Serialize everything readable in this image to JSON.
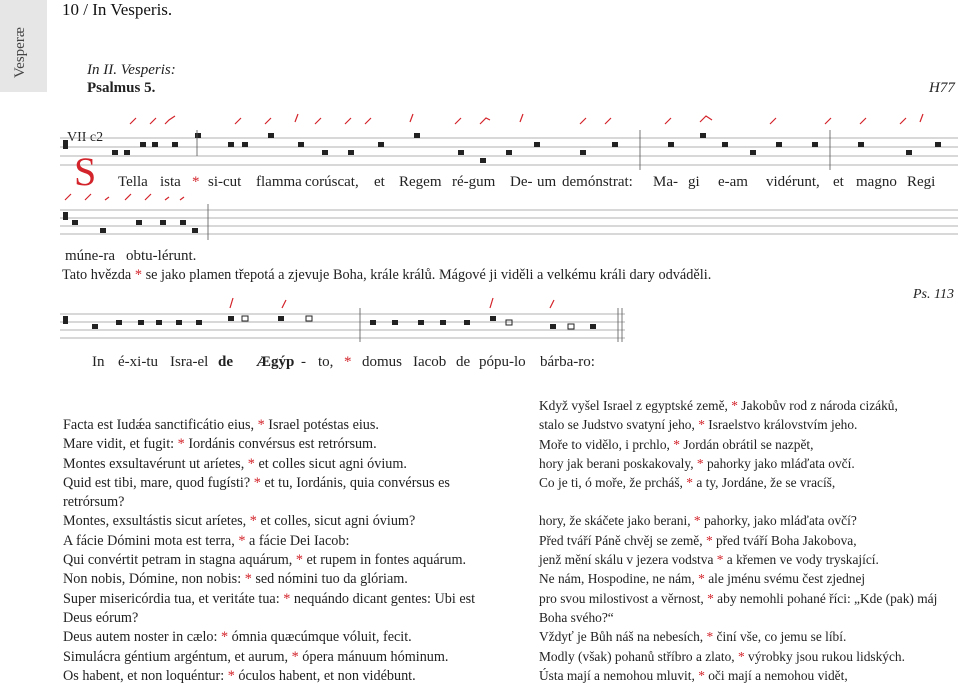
{
  "running_head": "10 / In Vesperis.",
  "side_tab": "Vesperæ",
  "rubric": "In II. Vesperis:",
  "psalm_title": "Psalmus 5.",
  "ref_h": "H77",
  "mode": "VII c2",
  "antiphon": {
    "initial": "S",
    "line1": [
      "Tella",
      "ista",
      "*",
      "si-cut",
      "flamma",
      "corúscat,",
      "et",
      "Regem",
      "ré-gum",
      "De-",
      "um",
      "demónstrat:",
      "Ma-",
      "gi",
      "e-am",
      "vidérunt,",
      "et",
      "magno",
      "Regi"
    ],
    "line2": [
      "múne-ra",
      "obtu-lérunt."
    ],
    "translation": "Tato hvězda * se jako plamen třepotá a zjevuje Boha, krále králů. Mágové ji viděli a velkému králi dary odváděli."
  },
  "psalm_tone": {
    "ref": "Ps. 113",
    "syllables": [
      "In",
      "é-xi-tu",
      "Isra-el",
      "de",
      "Ægýp",
      "-",
      "to,",
      "*",
      "domus",
      "Iacob",
      "de",
      "pópu-lo",
      "bárba-ro:"
    ]
  },
  "latin": [
    "Facta est Iudǽa sanctificátio eius, * Israel potéstas eius.",
    "Mare vidit, et fugit: * Iordánis convérsus est retrórsum.",
    "Montes exsultavérunt ut aríetes, * et colles sicut agni óvium.",
    "Quid est tibi, mare, quod fugísti? * et tu, Iordánis, quia convérsus es",
    "retrórsum?",
    "Montes, exsultástis sicut aríetes, * et colles, sicut agni óvium?",
    "A fácie Dómini mota est terra, * a fácie Dei Iacob:",
    "Qui convértit petram in stagna aquárum, * et rupem in fontes aquárum.",
    "Non nobis, Dómine, non nobis: * sed nómini tuo da glóriam.",
    "Super misericórdia tua, et veritáte tua: * nequándo dicant gentes: Ubi est",
    "Deus eórum?",
    "Deus autem noster in cælo: * ómnia quæcúmque vóluit, fecit.",
    "Simulácra géntium argéntum, et aurum, * ópera mánuum hóminum.",
    "Os habent, et non loquéntur: * óculos habent, et non vidébunt."
  ],
  "czech": [
    "Když vyšel Israel z egyptské země, * Jakobův rod z národa cizáků,",
    "stalo se Judstvo svatyní jeho, * Israelstvo královstvím jeho.",
    "Moře to vidělo, i prchlo, * Jordán obrátil se nazpět,",
    "hory jak berani poskakovaly, * pahorky jako mláďata ovčí.",
    "Co je ti, ó moře, že prcháš, * a ty, Jordáne, že se vracíš,",
    "",
    "hory, že skáčete jako berani, * pahorky, jako mláďata ovčí?",
    "Před tváří Páně chvěj se země, * před tváří Boha Jakobova,",
    "jenž mění skálu v jezera vodstva * a křemen ve vody tryskající.",
    "Ne nám, Hospodine, ne nám, * ale jménu svému čest zjednej",
    "pro svou milostivost a věrnost, * aby nemohli pohané říci: „Kde (pak) máj",
    "Boha svého?“",
    "Vždyť je Bůh náš na nebesích, * činí vše, co jemu se líbí.",
    "Modly (však) pohanů stříbro a zlato, * výrobky jsou rukou lidských.",
    "Ústa mají a nemohou mluvit, * oči mají a nemohou vidět,"
  ]
}
